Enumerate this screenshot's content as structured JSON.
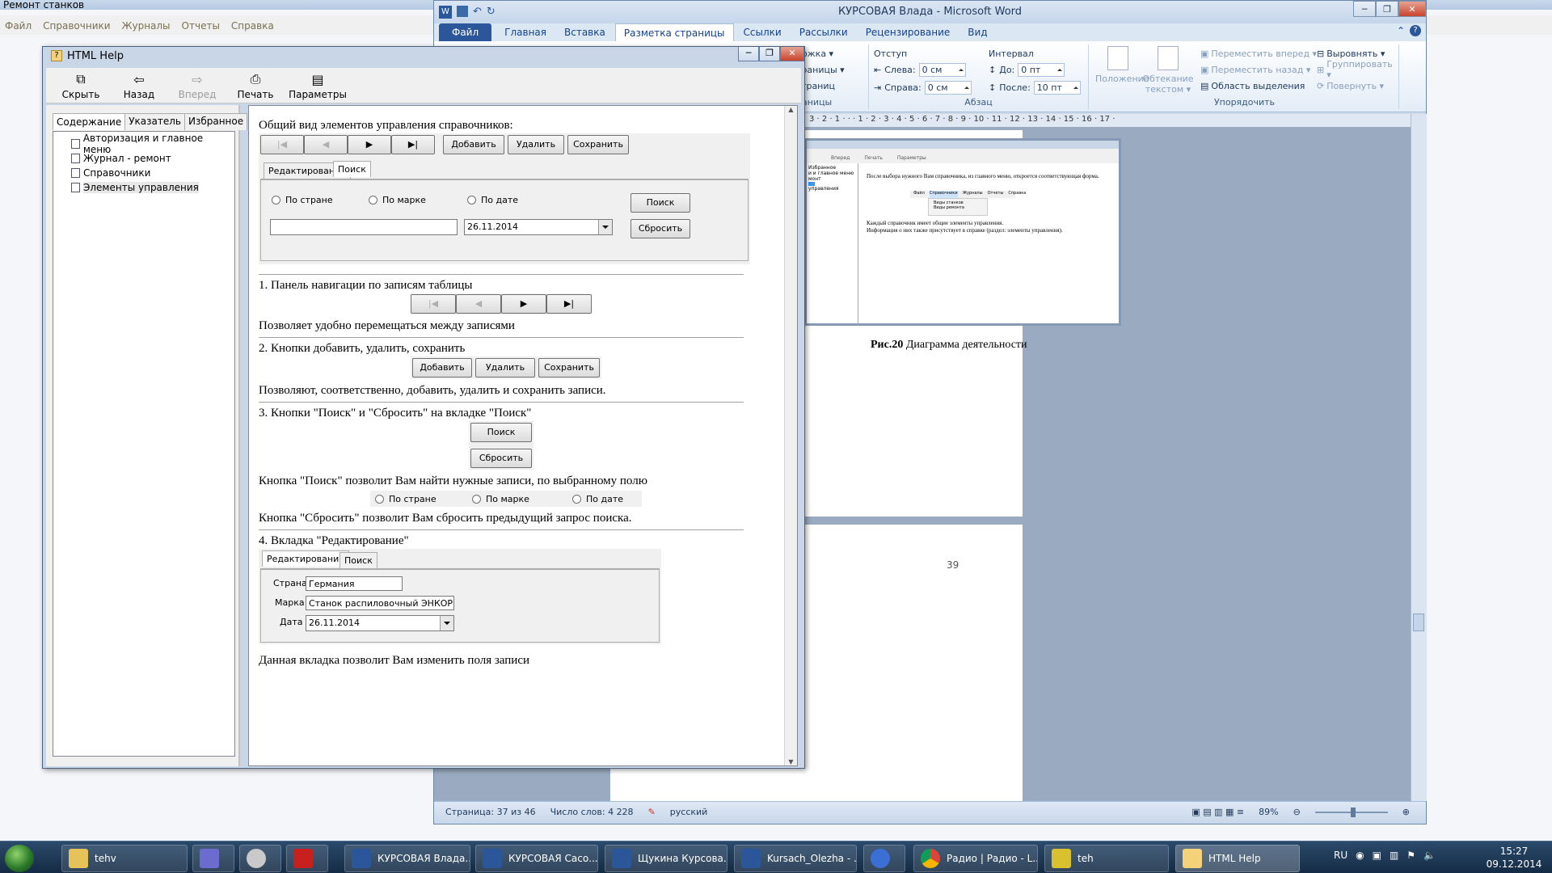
{
  "bg_app": {
    "title": "Ремонт станков",
    "menu": [
      "Файл",
      "Справочники",
      "Журналы",
      "Отчеты",
      "Справка"
    ]
  },
  "word": {
    "title": "КУРСОВАЯ Влада  -  Microsoft Word",
    "tabs": [
      "Файл",
      "Главная",
      "Вставка",
      "Разметка страницы",
      "Ссылки",
      "Рассылки",
      "Рецензирование",
      "Вид"
    ],
    "active_tab": "Разметка страницы",
    "ribbon": {
      "frag1": "ложка ▾",
      "frag2": "траницы ▾",
      "frag3": "страниц",
      "frag4": "раницы",
      "indent_title": "Отступ",
      "indent_left_label": "Слева:",
      "indent_left": "0 см",
      "indent_right_label": "Справа:",
      "indent_right": "0 см",
      "interval_title": "Интервал",
      "before_label": "До:",
      "before": "0 пт",
      "after_label": "После:",
      "after": "10 пт",
      "paragraph_group": "Абзац",
      "position": "Положение",
      "wrap": "Обтекание текстом ▾",
      "forward": "Переместить вперед ▾",
      "backward": "Переместить назад ▾",
      "selection": "Область выделения",
      "align": "Выровнять ▾",
      "group": "Группировать ▾",
      "rotate": "Повернуть ▾",
      "arrange_group": "Упорядочить"
    },
    "ruler": "3 · 2 · 1 · · · 1 · 2 · 3 · 4 · 5 · 6 · 7 · 8 · 9 · 10 · 11 · 12 · 13 · 14 · 15 · 16 · 17 ·",
    "embed": {
      "tb_forward": "Вперед",
      "tb_print": "Печать",
      "tb_params": "Параметры",
      "tab": "Избранное",
      "tree": [
        "и и главное меню",
        "монт",
        "",
        "управления"
      ],
      "text1": "После выбора нужного Вам справочника, из главного меню, откроется соответствующая форма.",
      "menu": [
        "Файл",
        "Справочники",
        "Журналы",
        "Отчеты",
        "Справка"
      ],
      "sub": [
        "Виды станков",
        "Виды ремонта"
      ],
      "text2": "Каждый справочник имеет общие элементы управления.",
      "text3": "Информация о них также присутствует в справке (раздел: элементы управления)."
    },
    "caption_bold": "Рис.20",
    "caption": " Диаграмма деятельности",
    "page_number": "39",
    "status": {
      "page": "Страница: 37 из 46",
      "words": "Число слов: 4 228",
      "lang": "русский",
      "zoom": "89%"
    }
  },
  "help": {
    "title": "HTML Help",
    "toolbar": [
      {
        "label": "Скрыть",
        "icon": "hide-icon",
        "enabled": true
      },
      {
        "label": "Назад",
        "icon": "back-icon",
        "enabled": true
      },
      {
        "label": "Вперед",
        "icon": "forward-icon",
        "enabled": false
      },
      {
        "label": "Печать",
        "icon": "print-icon",
        "enabled": true
      },
      {
        "label": "Параметры",
        "icon": "options-icon",
        "enabled": true
      }
    ],
    "left_tabs": [
      "Содержание",
      "Указатель",
      "Избранное"
    ],
    "tree": [
      "Авторизация и главное меню",
      "Журнал - ремонт",
      "Справочники",
      "Элементы управления"
    ],
    "content": {
      "heading": "Общий вид элементов управления справочников:",
      "nav": {
        "first": "|◀",
        "prev": "◀",
        "next": "▶",
        "last": "▶|"
      },
      "add": "Добавить",
      "delete": "Удалить",
      "save": "Сохранить",
      "tab_edit": "Редактирование",
      "tab_search": "Поиск",
      "radio_country": "По стране",
      "radio_brand": "По марке",
      "radio_date": "По дате",
      "search": "Поиск",
      "reset": "Сбросить",
      "date_value": "26.11.2014",
      "s1_title": "1. Панель навигации по записям таблицы",
      "s1_desc": "Позволяет удобно перемещаться между записями",
      "s2_title": "2. Кнопки добавить, удалить, сохранить",
      "s2_desc": "Позволяют, соответственно, добавить, удалить и сохранить записи.",
      "s3_title": "3. Кнопки \"Поиск\" и \"Сбросить\" на вкладке \"Поиск\"",
      "s3_desc1": "Кнопка \"Поиск\" позволит Вам найти нужные записи, по выбранному полю",
      "s3_desc2": "Кнопка \"Сбросить\" позволит Вам сбросить предыдущий запрос поиска.",
      "s4_title": "4. Вкладка \"Редактирование\"",
      "country_label": "Страна",
      "country_value": "Германия",
      "brand_label": "Марка",
      "brand_value": "Станок распиловочный ЭНКОР Кор",
      "date_label": "Дата",
      "s4_desc": "Данная вкладка позволит Вам изменить поля записи"
    }
  },
  "taskbar": {
    "items": [
      "tehv",
      "",
      "",
      "",
      "КУРСОВАЯ Влада...",
      "КУРСОВАЯ Сасо...",
      "Щукина Курсова...",
      "Kursach_Olezha - ...",
      "",
      "Радио | Радио - L...",
      "teh",
      "HTML Help"
    ],
    "lang": "RU",
    "time": "15:27",
    "date": "09.12.2014"
  }
}
